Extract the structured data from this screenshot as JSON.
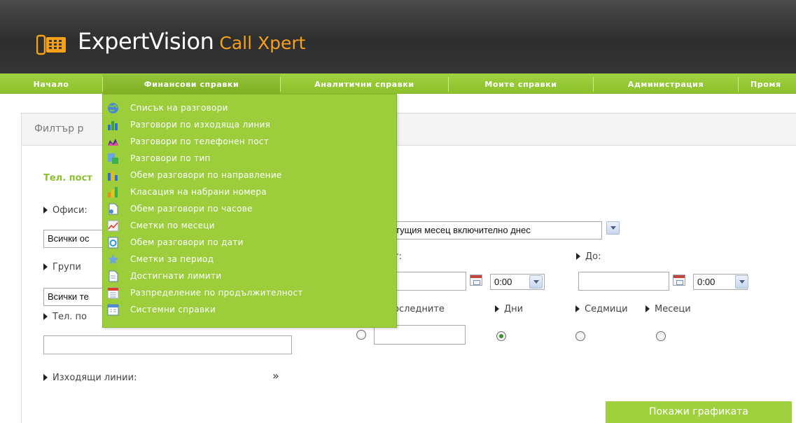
{
  "header": {
    "brand": "ExpertVision",
    "product": "Call Xpert"
  },
  "nav": {
    "items": [
      "Начало",
      "Финансови справки",
      "Аналитични справки",
      "Моите справки",
      "Администрация",
      "Промя"
    ]
  },
  "panel": {
    "title": "Филтър р"
  },
  "form": {
    "section_title": "Тел. пост",
    "section_title_right": ":",
    "offices_label": "Офиси:",
    "offices_value": "Всички ос",
    "groups_label": "Групи",
    "groups_value": "Всички те",
    "phone_label": "Тел. по",
    "phone_value": "",
    "outgoing_label": "Изходящи линии:",
    "chevron": "»",
    "period_value": "тущия месец включително днес",
    "from_label": "т:",
    "to_label": "До:",
    "from_date": "",
    "from_time": "0:00",
    "to_date": "",
    "to_time": "0:00",
    "last_label": "оследните",
    "days_label": "Дни",
    "weeks_label": "Седмици",
    "months_label": "Месеци",
    "last_value": "",
    "selected_unit": "Дни",
    "show_button": "Покажи графиката"
  },
  "menu": {
    "items": [
      {
        "label": "Списък на разговори",
        "icon": "globe-icon"
      },
      {
        "label": "Разговори по изходяща линия",
        "icon": "bar-chart-icon"
      },
      {
        "label": "Разговори по телефонен пост",
        "icon": "area-chart-icon"
      },
      {
        "label": "Разговори по тип",
        "icon": "puzzle-icon"
      },
      {
        "label": "Обем разговори по направление",
        "icon": "column-chart-icon"
      },
      {
        "label": "Класация на набрани номера",
        "icon": "ranking-chart-icon"
      },
      {
        "label": "Обем разговори по часове",
        "icon": "document-icon"
      },
      {
        "label": "Сметки по месеци",
        "icon": "line-chart-icon"
      },
      {
        "label": "Обем разговори по дати",
        "icon": "refresh-doc-icon"
      },
      {
        "label": "Сметки за период",
        "icon": "star-icon"
      },
      {
        "label": "Достигнати лимити",
        "icon": "document-icon"
      },
      {
        "label": "Разпределение по продължителност",
        "icon": "calendar-icon"
      },
      {
        "label": "Системни справки",
        "icon": "window-icon"
      }
    ]
  },
  "colors": {
    "accent_green": "#9fd13f",
    "logo_orange": "#f5a11b",
    "header_dark": "#3a3a3a"
  }
}
